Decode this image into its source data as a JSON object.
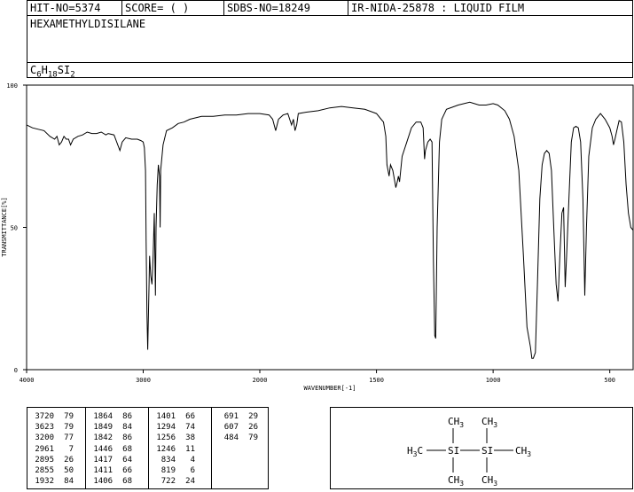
{
  "header": {
    "hit_no": "HIT-NO=5374",
    "score": "SCORE=  (  )",
    "sdbs_no": "SDBS-NO=18249",
    "ir_nida": "IR-NIDA-25878 : LIQUID FILM",
    "compound_name": "HEXAMETHYLDISILANE",
    "formula": {
      "c": "C",
      "c_sub": "6",
      "h": "H",
      "h_sub": "18",
      "si": "SI",
      "si_sub": "2"
    }
  },
  "chart_data": {
    "type": "line",
    "title": "",
    "xlabel": "WAVENUMBER[-1]",
    "ylabel": "TRANSMITTANCE[%]",
    "xlim": [
      4000,
      400
    ],
    "ylim": [
      0,
      100
    ],
    "x_ticks": [
      "4000",
      "3000",
      "2000",
      "1500",
      "1000",
      "500"
    ],
    "y_ticks": [
      "100",
      "50",
      "0"
    ],
    "grid": false,
    "series": [
      {
        "values": [
          [
            4000,
            86
          ],
          [
            3950,
            85
          ],
          [
            3900,
            84.5
          ],
          [
            3850,
            84
          ],
          [
            3800,
            82
          ],
          [
            3760,
            81
          ],
          [
            3740,
            82
          ],
          [
            3720,
            79
          ],
          [
            3700,
            80
          ],
          [
            3680,
            82
          ],
          [
            3660,
            81
          ],
          [
            3640,
            81
          ],
          [
            3623,
            79
          ],
          [
            3600,
            81
          ],
          [
            3560,
            82
          ],
          [
            3520,
            82.5
          ],
          [
            3480,
            83.5
          ],
          [
            3440,
            83
          ],
          [
            3400,
            83
          ],
          [
            3360,
            83.5
          ],
          [
            3320,
            82.5
          ],
          [
            3300,
            83
          ],
          [
            3250,
            82.5
          ],
          [
            3200,
            77
          ],
          [
            3180,
            80
          ],
          [
            3150,
            81.5
          ],
          [
            3100,
            81
          ],
          [
            3050,
            81
          ],
          [
            3020,
            80.5
          ],
          [
            3000,
            80
          ],
          [
            2990,
            78
          ],
          [
            2980,
            70
          ],
          [
            2975,
            45
          ],
          [
            2968,
            20
          ],
          [
            2961,
            7
          ],
          [
            2950,
            30
          ],
          [
            2945,
            40
          ],
          [
            2935,
            33
          ],
          [
            2925,
            30
          ],
          [
            2915,
            40
          ],
          [
            2905,
            55
          ],
          [
            2895,
            26
          ],
          [
            2890,
            50
          ],
          [
            2880,
            65
          ],
          [
            2870,
            72
          ],
          [
            2860,
            68
          ],
          [
            2855,
            50
          ],
          [
            2850,
            70
          ],
          [
            2830,
            79
          ],
          [
            2800,
            84
          ],
          [
            2750,
            85
          ],
          [
            2700,
            86.5
          ],
          [
            2650,
            87
          ],
          [
            2600,
            88
          ],
          [
            2550,
            88.5
          ],
          [
            2500,
            89
          ],
          [
            2400,
            89
          ],
          [
            2300,
            89.5
          ],
          [
            2200,
            89.5
          ],
          [
            2100,
            90
          ],
          [
            2000,
            90
          ],
          [
            1960,
            89.5
          ],
          [
            1945,
            88
          ],
          [
            1932,
            84
          ],
          [
            1920,
            88
          ],
          [
            1900,
            89.5
          ],
          [
            1880,
            90
          ],
          [
            1864,
            86
          ],
          [
            1856,
            88
          ],
          [
            1849,
            84
          ],
          [
            1842,
            86
          ],
          [
            1835,
            90
          ],
          [
            1800,
            90.5
          ],
          [
            1750,
            91
          ],
          [
            1700,
            92
          ],
          [
            1650,
            92.5
          ],
          [
            1600,
            92
          ],
          [
            1550,
            91.5
          ],
          [
            1500,
            90
          ],
          [
            1480,
            88
          ],
          [
            1470,
            87
          ],
          [
            1460,
            82
          ],
          [
            1455,
            72
          ],
          [
            1446,
            68
          ],
          [
            1440,
            72
          ],
          [
            1430,
            70
          ],
          [
            1417,
            64
          ],
          [
            1411,
            66
          ],
          [
            1406,
            68
          ],
          [
            1401,
            66
          ],
          [
            1390,
            75
          ],
          [
            1370,
            80
          ],
          [
            1350,
            85
          ],
          [
            1330,
            87
          ],
          [
            1310,
            87
          ],
          [
            1300,
            85
          ],
          [
            1294,
            74
          ],
          [
            1290,
            77
          ],
          [
            1280,
            80
          ],
          [
            1270,
            81
          ],
          [
            1262,
            80
          ],
          [
            1256,
            38
          ],
          [
            1250,
            12
          ],
          [
            1246,
            11
          ],
          [
            1240,
            50
          ],
          [
            1230,
            80
          ],
          [
            1220,
            88
          ],
          [
            1200,
            91.5
          ],
          [
            1150,
            93
          ],
          [
            1100,
            94
          ],
          [
            1060,
            93
          ],
          [
            1030,
            93
          ],
          [
            1000,
            93.5
          ],
          [
            980,
            93
          ],
          [
            950,
            91
          ],
          [
            930,
            88
          ],
          [
            910,
            82
          ],
          [
            890,
            70
          ],
          [
            870,
            40
          ],
          [
            855,
            15
          ],
          [
            840,
            8
          ],
          [
            834,
            4
          ],
          [
            828,
            4
          ],
          [
            819,
            6
          ],
          [
            810,
            30
          ],
          [
            800,
            60
          ],
          [
            790,
            72
          ],
          [
            780,
            76
          ],
          [
            770,
            77
          ],
          [
            760,
            76
          ],
          [
            750,
            70
          ],
          [
            740,
            50
          ],
          [
            730,
            30
          ],
          [
            722,
            24
          ],
          [
            714,
            40
          ],
          [
            705,
            55
          ],
          [
            698,
            57
          ],
          [
            691,
            29
          ],
          [
            685,
            40
          ],
          [
            675,
            60
          ],
          [
            665,
            80
          ],
          [
            655,
            85
          ],
          [
            645,
            85.5
          ],
          [
            635,
            85
          ],
          [
            625,
            80
          ],
          [
            615,
            60
          ],
          [
            607,
            26
          ],
          [
            600,
            50
          ],
          [
            590,
            75
          ],
          [
            575,
            85
          ],
          [
            560,
            88
          ],
          [
            540,
            90
          ],
          [
            520,
            88
          ],
          [
            500,
            85
          ],
          [
            490,
            82
          ],
          [
            484,
            79
          ],
          [
            478,
            81
          ],
          [
            470,
            84
          ],
          [
            460,
            87.5
          ],
          [
            450,
            87
          ],
          [
            440,
            80
          ],
          [
            430,
            65
          ],
          [
            420,
            55
          ],
          [
            410,
            50
          ],
          [
            400,
            49
          ]
        ]
      }
    ],
    "peak_table": [
      [
        [
          "3720",
          "79"
        ],
        [
          "3623",
          "79"
        ],
        [
          "3200",
          "77"
        ],
        [
          "2961",
          "7"
        ],
        [
          "2895",
          "26"
        ],
        [
          "2855",
          "50"
        ],
        [
          "1932",
          "84"
        ]
      ],
      [
        [
          "1864",
          "86"
        ],
        [
          "1849",
          "84"
        ],
        [
          "1842",
          "86"
        ],
        [
          "1446",
          "68"
        ],
        [
          "1417",
          "64"
        ],
        [
          "1411",
          "66"
        ],
        [
          "1406",
          "68"
        ]
      ],
      [
        [
          "1401",
          "66"
        ],
        [
          "1294",
          "74"
        ],
        [
          "1256",
          "38"
        ],
        [
          "1246",
          "11"
        ],
        [
          "834",
          "4"
        ],
        [
          "819",
          "6"
        ],
        [
          "722",
          "24"
        ]
      ],
      [
        [
          "691",
          "29"
        ],
        [
          "607",
          "26"
        ],
        [
          "484",
          "79"
        ]
      ]
    ]
  },
  "structure": {
    "ch3_1": "CH3",
    "ch3_2": "CH3",
    "ch3_3": "CH3",
    "ch3_4": "CH3",
    "h3c": "H3C",
    "si_1": "SI",
    "si_2": "SI",
    "ch3_right": "CH3"
  }
}
